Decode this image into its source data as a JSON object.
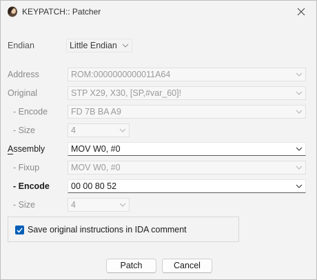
{
  "window": {
    "title": "KEYPATCH:: Patcher"
  },
  "endian": {
    "label": "Endian",
    "value": "Little Endian"
  },
  "address": {
    "label": "Address",
    "value": "ROM:0000000000011A64"
  },
  "original": {
    "label": "Original",
    "value": "STP X29, X30, [SP,#var_60]!",
    "encode": {
      "label": "-  Encode",
      "value": "FD 7B BA A9"
    },
    "size": {
      "label": "-  Size",
      "value": "4"
    }
  },
  "assembly": {
    "label": "Assembly",
    "value": "MOV W0, #0",
    "fixup": {
      "label": "-  Fixup",
      "value": "MOV W0, #0"
    },
    "encode": {
      "label": "-  Encode",
      "value": "00 00 80 52"
    },
    "size": {
      "label": "-  Size",
      "value": "4"
    }
  },
  "options": {
    "save_comment_label": "Save original instructions in IDA comment",
    "save_comment_checked": true
  },
  "buttons": {
    "patch": "Patch",
    "cancel": "Cancel"
  },
  "colors": {
    "accent": "#005fb8",
    "disabled_text": "#8a8a8a"
  }
}
